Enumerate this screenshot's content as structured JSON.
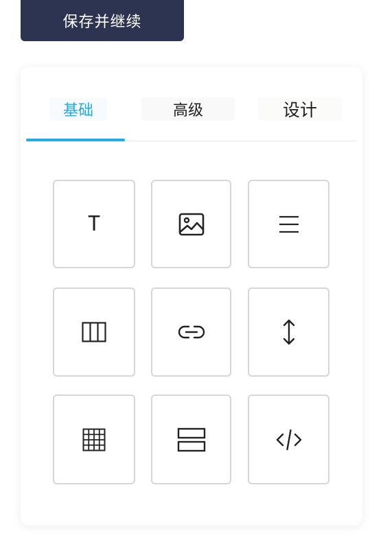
{
  "header": {
    "save_continue_label": "保存并继续"
  },
  "tabs": [
    {
      "id": "basic",
      "label": "基础",
      "active": true
    },
    {
      "id": "advanced",
      "label": "高级",
      "active": false
    },
    {
      "id": "design",
      "label": "设计",
      "active": false
    }
  ],
  "widgets": [
    {
      "icon": "text-icon",
      "glyph": "T"
    },
    {
      "icon": "image-icon"
    },
    {
      "icon": "menu-lines-icon"
    },
    {
      "icon": "columns-icon"
    },
    {
      "icon": "link-icon"
    },
    {
      "icon": "vertical-spacer-icon"
    },
    {
      "icon": "grid-table-icon"
    },
    {
      "icon": "rows-icon"
    },
    {
      "icon": "code-icon"
    }
  ],
  "colors": {
    "accent": "#1eaee3",
    "save_button_bg": "#2d3451",
    "tile_border": "#d6d6d6"
  }
}
